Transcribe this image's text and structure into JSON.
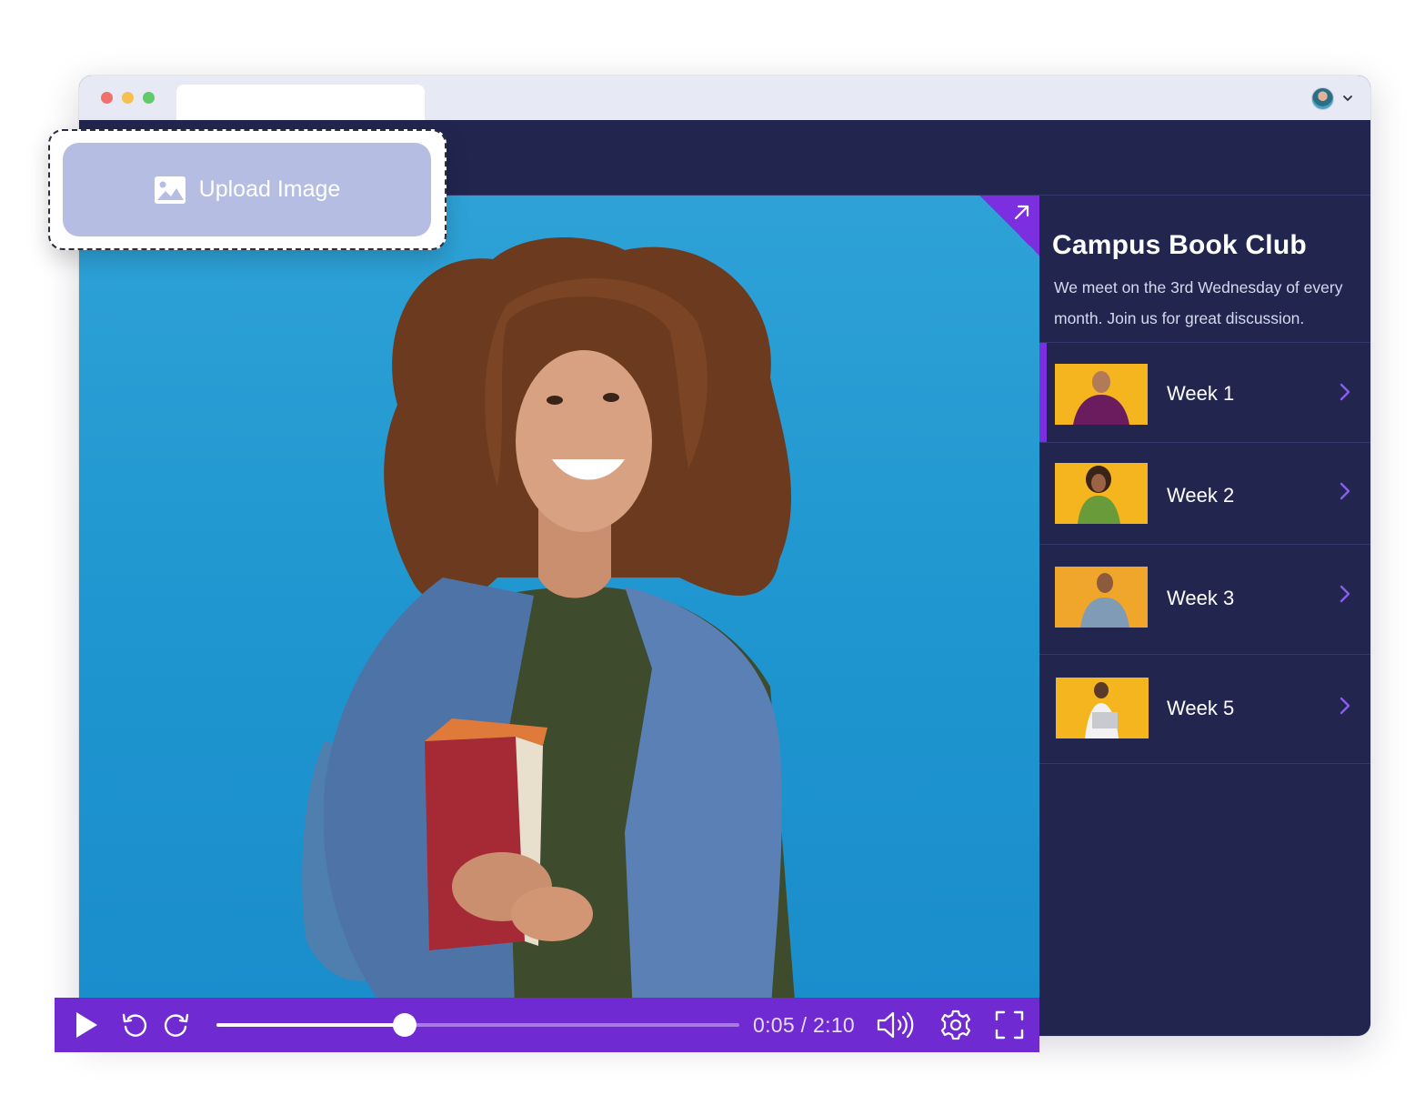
{
  "upload": {
    "label": "Upload Image",
    "icon": "image-icon"
  },
  "browser": {
    "avatar_icon": "user-avatar",
    "menu_icon": "chevron-down-icon"
  },
  "video": {
    "image": "student-holding-books-photo",
    "expand_icon": "arrow-up-right-icon"
  },
  "sidebar": {
    "title": "Campus Book Club",
    "description": "We meet on the 3rd Wednesday of every month. Join us for great discussion.",
    "items": [
      {
        "label": "Week 1",
        "active": true
      },
      {
        "label": "Week 2",
        "active": false
      },
      {
        "label": "Week 3",
        "active": false
      },
      {
        "label": "Week 5",
        "active": false
      }
    ]
  },
  "player": {
    "time": "0:05 / 2:10",
    "progress": 0.36,
    "icons": [
      "play-icon",
      "rewind-icon",
      "forward-icon",
      "volume-icon",
      "settings-icon",
      "fullscreen-icon"
    ]
  },
  "colors": {
    "accent": "#6f2bd1",
    "panel": "#22264f",
    "video_bg": "#1e95cf",
    "thumb_bg": "#f4b51e",
    "upload_bg": "#b5bde3"
  }
}
